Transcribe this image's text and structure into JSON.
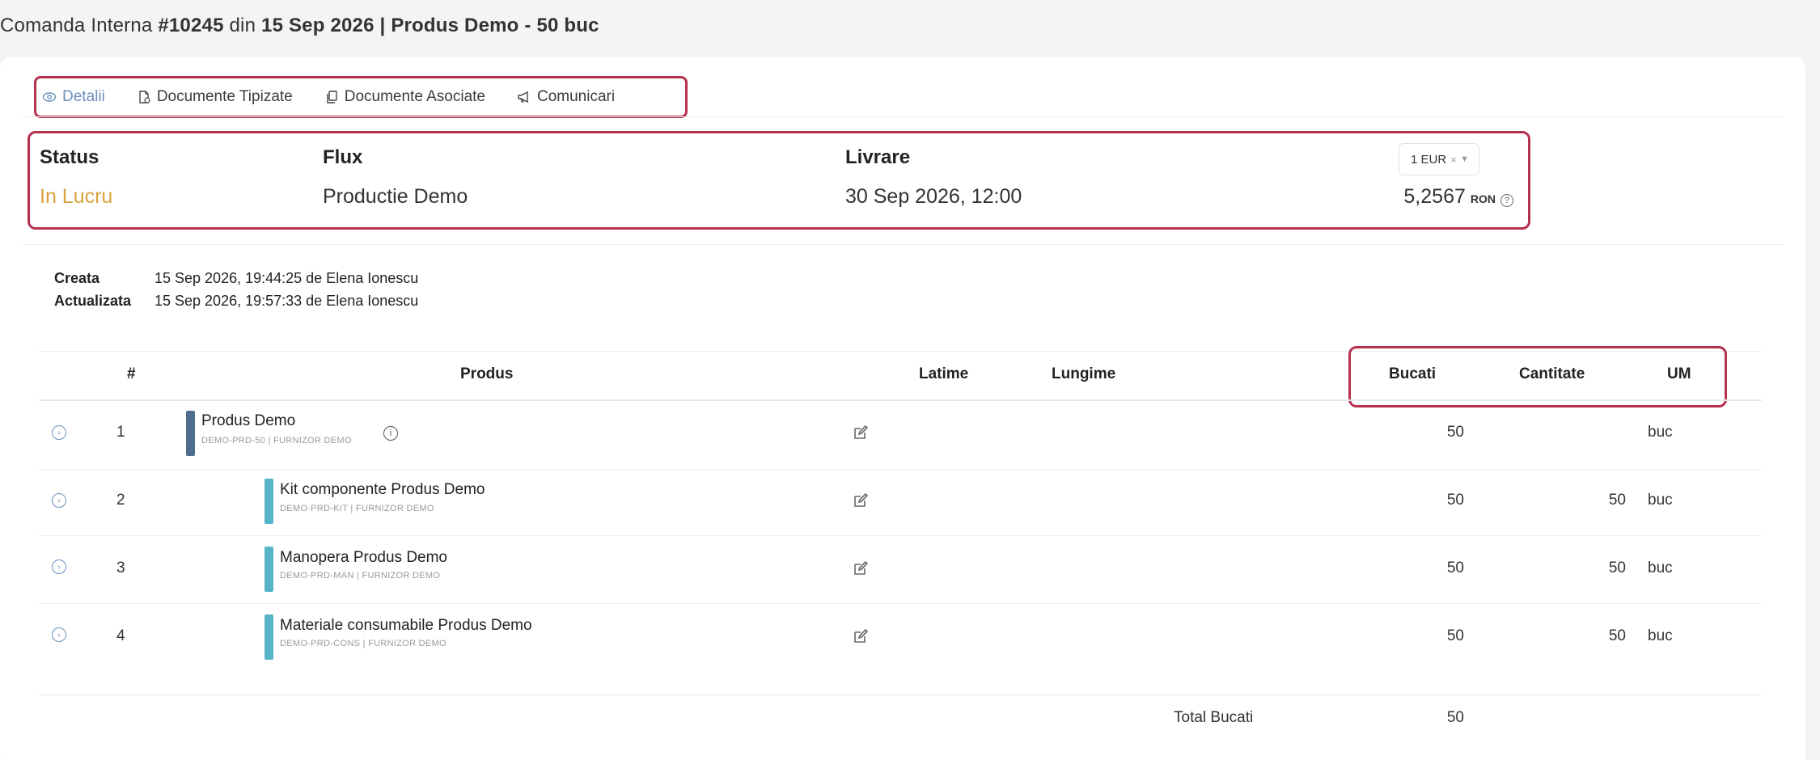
{
  "page": {
    "title_prefix": "Comanda Interna",
    "order_no": "#10245",
    "din": "din",
    "date": "15 Sep 2026",
    "rest": "| Produs Demo - 50 buc"
  },
  "tabs": [
    {
      "label": "Detalii",
      "icon": "eye-icon",
      "active": true
    },
    {
      "label": "Documente Tipizate",
      "icon": "document-icon",
      "active": false
    },
    {
      "label": "Documente Asociate",
      "icon": "copy-icon",
      "active": false
    },
    {
      "label": "Comunicari",
      "icon": "megaphone-icon",
      "active": false
    }
  ],
  "info": {
    "status_label": "Status",
    "status_value": "In Lucru",
    "flux_label": "Flux",
    "flux_value": "Productie Demo",
    "livrare_label": "Livrare",
    "livrare_value": "30 Sep 2026, 12:00",
    "currency_selected": "1 EUR",
    "currency_clear": "×",
    "rate_value": "5,2567",
    "rate_unit": "RON",
    "status_color": "#d9a23c"
  },
  "meta": {
    "created_label": "Creata",
    "created_value": "15 Sep 2026, 19:44:25 de Elena Ionescu",
    "updated_label": "Actualizata",
    "updated_value": "15 Sep 2026, 19:57:33 de Elena Ionescu"
  },
  "table": {
    "headers": {
      "index": "#",
      "produs": "Produs",
      "latime": "Latime",
      "lungime": "Lungime",
      "bucati": "Bucati",
      "cantitate": "Cantitate",
      "um": "UM"
    },
    "rows": [
      {
        "idx": "1",
        "name": "Produs Demo",
        "sub": "DEMO-PRD-50 | FURNIZOR DEMO",
        "bucati": "50",
        "cantitate": "",
        "um": "buc",
        "bar_color": "#4f6e8f"
      },
      {
        "idx": "2",
        "name": "Kit componente Produs Demo",
        "sub": "DEMO-PRD-KIT | FURNIZOR DEMO",
        "bucati": "50",
        "cantitate": "50",
        "um": "buc",
        "bar_color": "#56b4c9"
      },
      {
        "idx": "3",
        "name": "Manopera Produs Demo",
        "sub": "DEMO-PRD-MAN | FURNIZOR DEMO",
        "bucati": "50",
        "cantitate": "50",
        "um": "buc",
        "bar_color": "#56b4c9"
      },
      {
        "idx": "4",
        "name": "Materiale consumabile Produs Demo",
        "sub": "DEMO-PRD-CONS | FURNIZOR DEMO",
        "bucati": "50",
        "cantitate": "50",
        "um": "buc",
        "bar_color": "#56b4c9"
      }
    ],
    "total_label": "Total Bucati",
    "total_value": "50"
  }
}
